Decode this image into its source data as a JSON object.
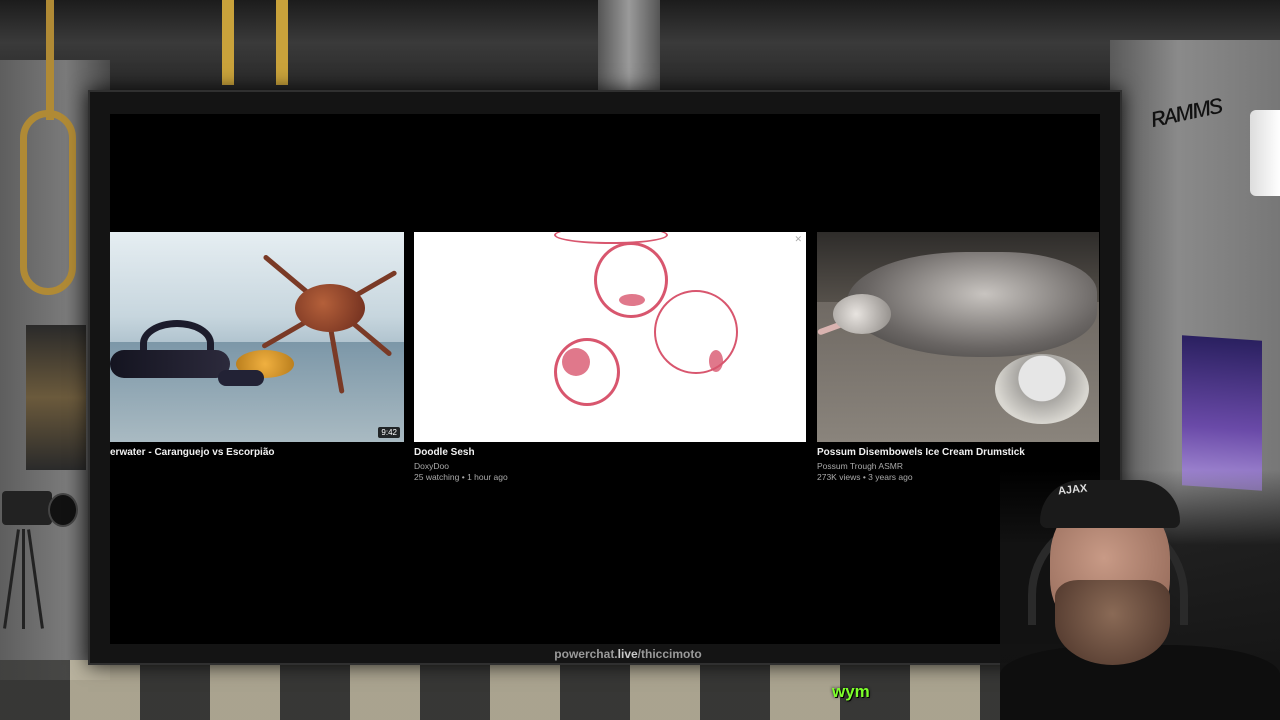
{
  "scene": {
    "url_prefix": "powerchat.",
    "url_accent": "live",
    "url_suffix": "/thiccimoto",
    "chat_word": "wym",
    "cap_logo": "AJAX"
  },
  "videos": [
    {
      "title": "erwater - Caranguejo vs Escorpião",
      "duration": "9:42",
      "thumbnail_icon": "crab-scorpion-thumbnail"
    },
    {
      "title": "Doodle Sesh",
      "channel": "DoxyDoo",
      "meta": "25 watching • 1 hour ago",
      "thumbnail_icon": "sketch-thumbnail"
    },
    {
      "title": "Possum Disembowels Ice Cream Drumstick",
      "channel": "Possum Trough ASMR",
      "meta": "273K views • 3 years ago",
      "thumbnail_icon": "possum-thumbnail"
    }
  ],
  "colors": {
    "chat_text": "#7dff2a",
    "sketch_stroke": "#d8566e",
    "screen_bg": "#000000"
  }
}
